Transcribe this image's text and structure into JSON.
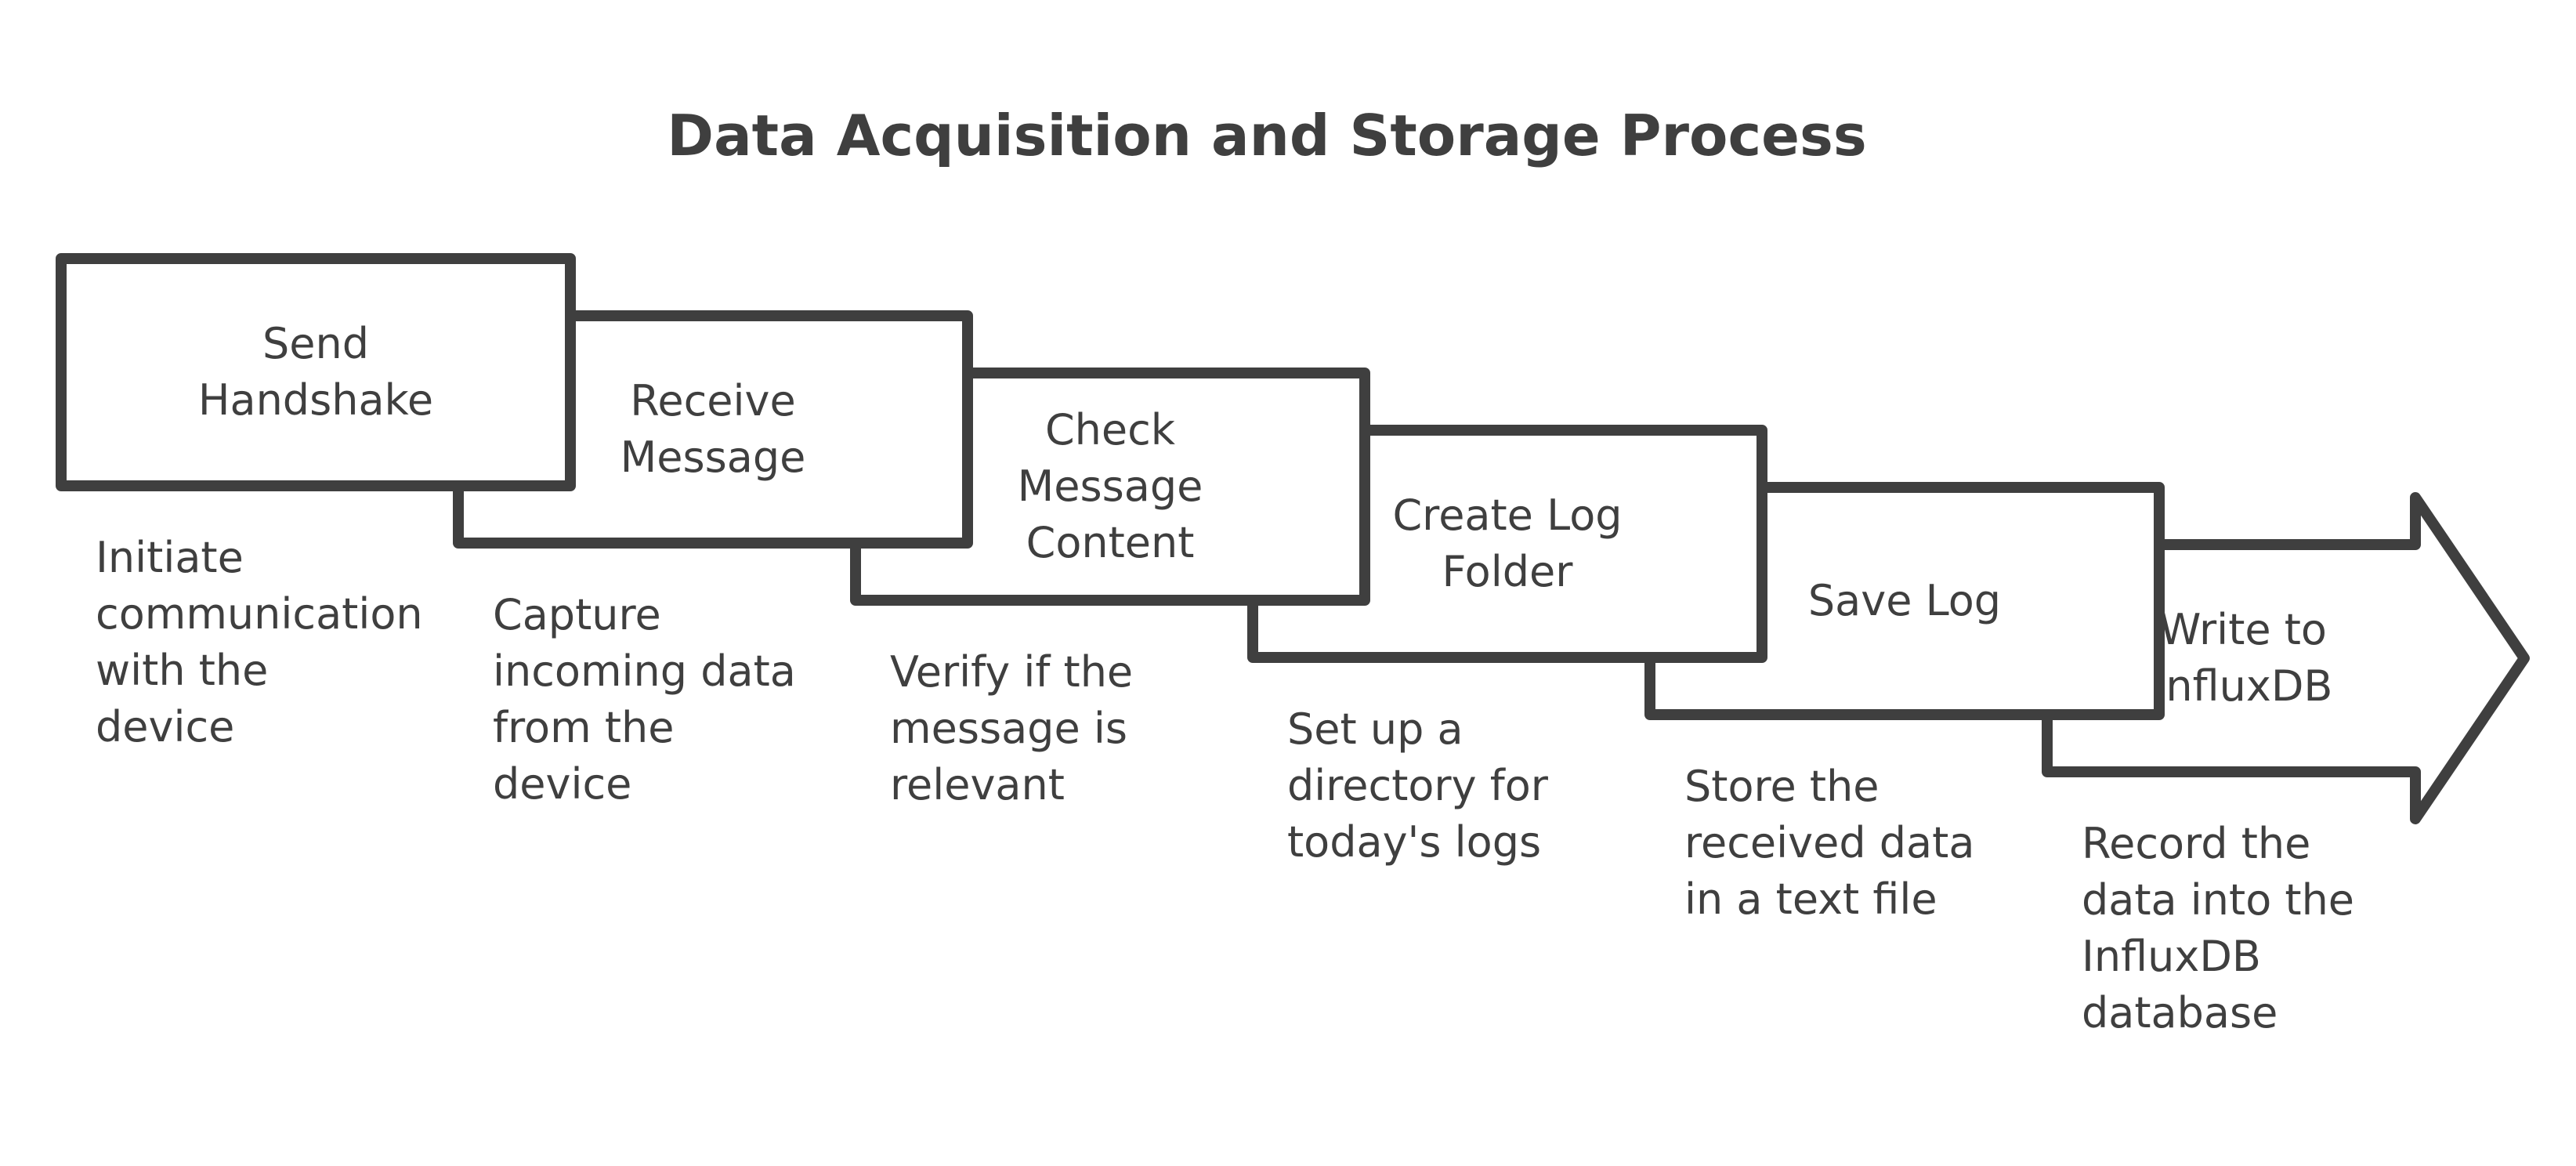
{
  "title": "Data Acquisition and Storage Process",
  "colors": {
    "stroke": "#3f3f3f",
    "fill": "#ffffff",
    "text": "#3f3f3f"
  },
  "steps": [
    {
      "label_lines": [
        "Send",
        "Handshake"
      ],
      "description_lines": [
        "Initiate",
        "communication",
        "with the",
        "device"
      ]
    },
    {
      "label_lines": [
        "Receive",
        "Message"
      ],
      "description_lines": [
        "Capture",
        "incoming data",
        "from the",
        "device"
      ]
    },
    {
      "label_lines": [
        "Check",
        "Message",
        "Content"
      ],
      "description_lines": [
        "Verify if the",
        "message is",
        "relevant"
      ]
    },
    {
      "label_lines": [
        "Create Log",
        "Folder"
      ],
      "description_lines": [
        "Set up a",
        "directory for",
        "today's logs"
      ]
    },
    {
      "label_lines": [
        "Save Log"
      ],
      "description_lines": [
        "Store the",
        "received data",
        "in a text file"
      ]
    },
    {
      "label_lines": [
        "Write to",
        "InfluxDB"
      ],
      "description_lines": [
        "Record the",
        "data into the",
        "InfluxDB",
        "database"
      ]
    }
  ]
}
